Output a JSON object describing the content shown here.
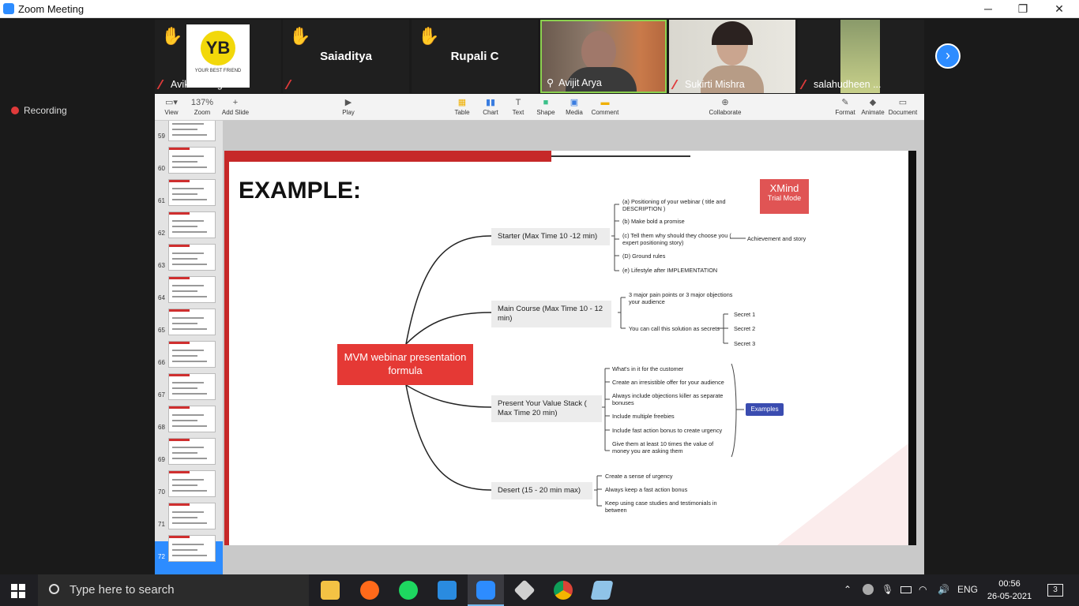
{
  "window": {
    "title": "Zoom Meeting",
    "minimize": "─",
    "restore": "❐",
    "close": "✕"
  },
  "participants": [
    {
      "name": "Avikaa Singh",
      "logo_letters": "YB",
      "logo_caption": "YOUR BEST FRIEND"
    },
    {
      "name": "Saiaditya"
    },
    {
      "name": "Rupali C"
    },
    {
      "name": "Avijit Arya"
    },
    {
      "name": "Sukirti Mishra"
    },
    {
      "name": "salahudheen ..."
    }
  ],
  "recording": {
    "label": "Recording"
  },
  "toolbar": {
    "view": "View",
    "zoom_value": "137%",
    "zoom": "Zoom",
    "add_slide": "Add Slide",
    "play": "Play",
    "table": "Table",
    "chart": "Chart",
    "text": "Text",
    "shape": "Shape",
    "media": "Media",
    "comment": "Comment",
    "collaborate": "Collaborate",
    "format": "Format",
    "animate": "Animate",
    "document": "Document"
  },
  "slide_numbers": [
    "59",
    "60",
    "61",
    "62",
    "63",
    "64",
    "65",
    "66",
    "67",
    "68",
    "69",
    "70",
    "71",
    "72"
  ],
  "slide": {
    "heading": "EXAMPLE:",
    "watermark_title": "XMind",
    "watermark_sub": "Trial Mode",
    "root": "MVM webinar presentation formula",
    "branches": {
      "starter": "Starter (Max Time 10 -12 min)",
      "main": "Main Course (Max Time 10 - 12 min)",
      "value": "Present Your Value Stack ( Max Time 20 min)",
      "desert": "Desert (15 - 20 min max)"
    },
    "starter_items": [
      "(a) Positioning of your webinar ( title and DESCRIPTION )",
      "(b) Make bold a promise",
      "(c) Tell them why should they choose you ( expert positioning story)",
      "(D) Ground rules",
      "(e) Lifestyle  after IMPLEMENTATION"
    ],
    "starter_extra": "Achievement and story",
    "main_items": [
      "3 major pain points or 3 major objections your audience",
      "You can call this solution as secrets"
    ],
    "secrets": [
      "Secret 1",
      "Secret 2",
      "Secret 3"
    ],
    "value_items": [
      "What's in it for the customer",
      "Create an irresistible offer for your audience",
      "Always include objections killer as separate bonuses",
      "Include multiple freebies",
      "Include fast action bonus to create urgency",
      "Give them at least 10 times the value of money you are asking them"
    ],
    "examples_tag": "Examples",
    "desert_items": [
      "Create a sense of urgency",
      "Always keep a fast action bonus",
      "Keep using case studies and testimonials in between"
    ]
  },
  "taskbar": {
    "search_placeholder": "Type here to search",
    "lang": "ENG",
    "time": "00:56",
    "date": "26-05-2021",
    "notif_count": "3"
  }
}
